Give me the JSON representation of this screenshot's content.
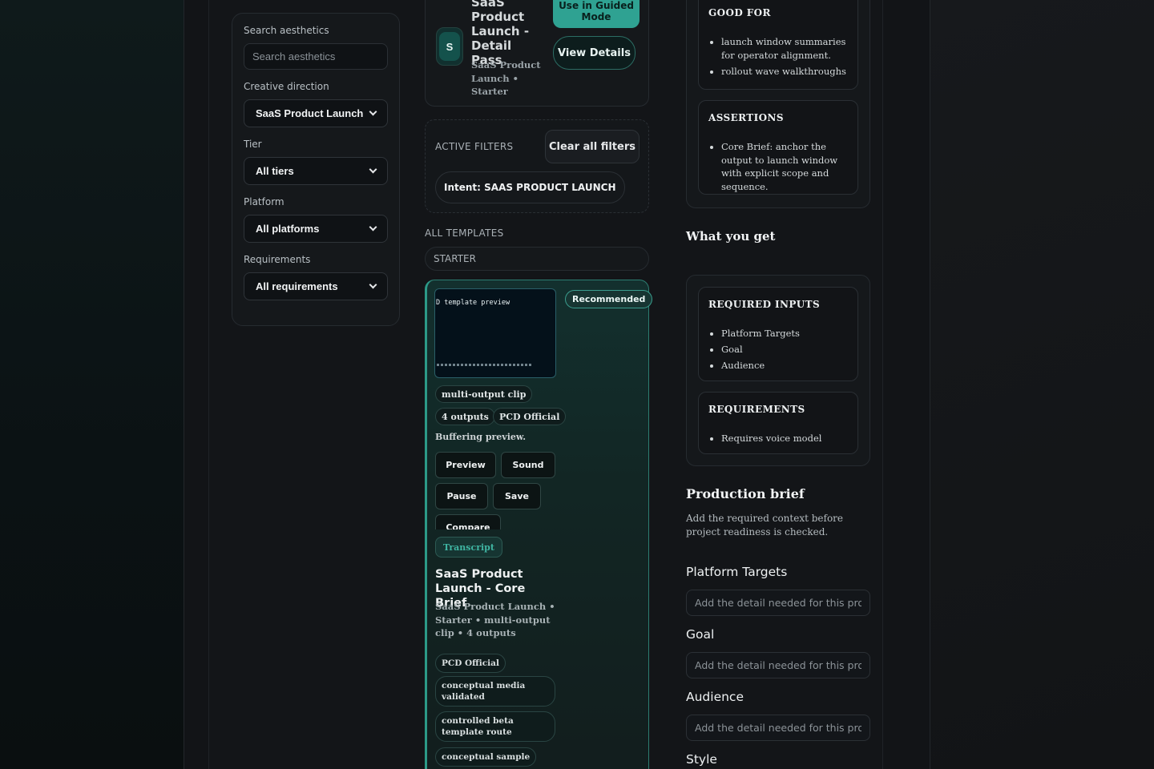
{
  "filters": {
    "search_label": "Search aesthetics",
    "search_placeholder": "Search aesthetics",
    "direction_label": "Creative direction",
    "direction_value": "SaaS Product Launch",
    "tier_label": "Tier",
    "tier_value": "All tiers",
    "platform_label": "Platform",
    "platform_value": "All platforms",
    "requirements_label": "Requirements",
    "requirements_value": "All requirements"
  },
  "top_card": {
    "avatar_letter": "S",
    "title": "SaaS Product Launch - Detail Pass",
    "subtitle": "SaaS Product Launch • Starter",
    "guided_button": "Use in Guided Mode",
    "details_button": "View Details"
  },
  "active_filters": {
    "label": "ACTIVE FILTERS",
    "clear_button": "Clear all filters",
    "chip": "Intent: SAAS PRODUCT LAUNCH"
  },
  "templates": {
    "heading": "ALL TEMPLATES",
    "group": "STARTER"
  },
  "template_card": {
    "preview_text": "D template preview",
    "badge": "Recommended",
    "pill_type": "multi-output clip",
    "pill_outputs": "4 outputs",
    "pill_official": "PCD Official",
    "status": "Buffering preview.",
    "btn_preview": "Preview",
    "btn_sound": "Sound",
    "btn_pause": "Pause",
    "btn_save": "Save",
    "btn_compare": "Compare",
    "transcript": "Transcript",
    "title": "SaaS Product Launch - Core Brief",
    "subtitle": "SaaS Product Launch • Starter • multi-output clip • 4 outputs",
    "tags": [
      "PCD Official",
      "conceptual media validated",
      "controlled beta template route",
      "conceptual sample"
    ]
  },
  "details": {
    "good_for_heading": "GOOD FOR",
    "good_for_items": [
      "launch window summaries for operator alignment.",
      "rollout wave walkthroughs"
    ],
    "assertions_heading": "ASSERTIONS",
    "assertions_items": [
      "Core Brief: anchor the output to launch window with explicit scope and sequence."
    ],
    "what_you_get_title": "What you get",
    "required_inputs_heading": "REQUIRED INPUTS",
    "required_inputs_items": [
      "Platform Targets",
      "Goal",
      "Audience"
    ],
    "requirements_heading": "REQUIREMENTS",
    "requirements_items": [
      "Requires voice model"
    ]
  },
  "brief": {
    "title": "Production brief",
    "description": "Add the required context before project readiness is checked.",
    "fields": [
      {
        "label": "Platform Targets",
        "placeholder": "Add the detail needed for this product"
      },
      {
        "label": "Goal",
        "placeholder": "Add the detail needed for this product"
      },
      {
        "label": "Audience",
        "placeholder": "Add the detail needed for this product"
      },
      {
        "label": "Style",
        "placeholder": ""
      }
    ]
  }
}
